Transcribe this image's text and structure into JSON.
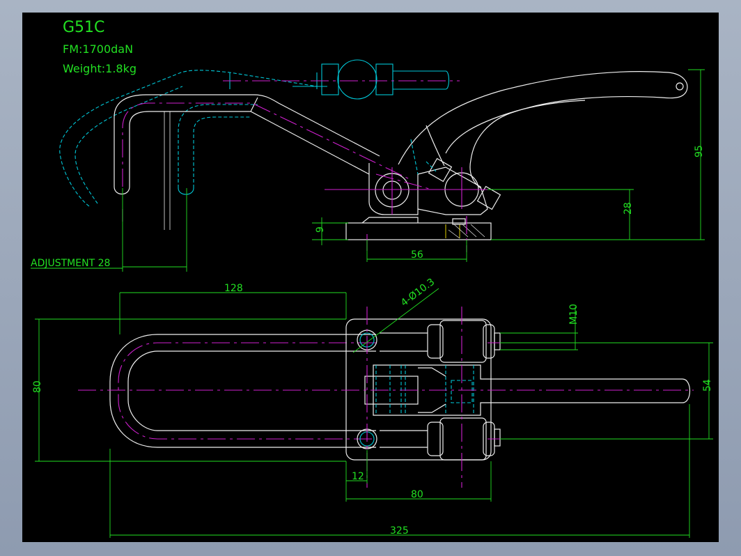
{
  "title_block": {
    "model": "G51C",
    "force": "FM:1700daN",
    "weight": "Weight:1.8kg"
  },
  "dimensions": {
    "adjustment": "ADJUSTMENT 28",
    "d9": "9",
    "d56": "56",
    "d28": "28",
    "d95": "95",
    "d128": "128",
    "holes": "4-Ø10.3",
    "m10": "M10",
    "d80_left": "80",
    "d54": "54",
    "d12": "12",
    "d80_bottom": "80",
    "d325": "325"
  },
  "colors": {
    "background": "#000000",
    "outline": "#f0f0f0",
    "hidden": "#00c8d8",
    "centerline": "#d020d0",
    "dimension": "#22e022",
    "frame": "#a9b4c4"
  }
}
